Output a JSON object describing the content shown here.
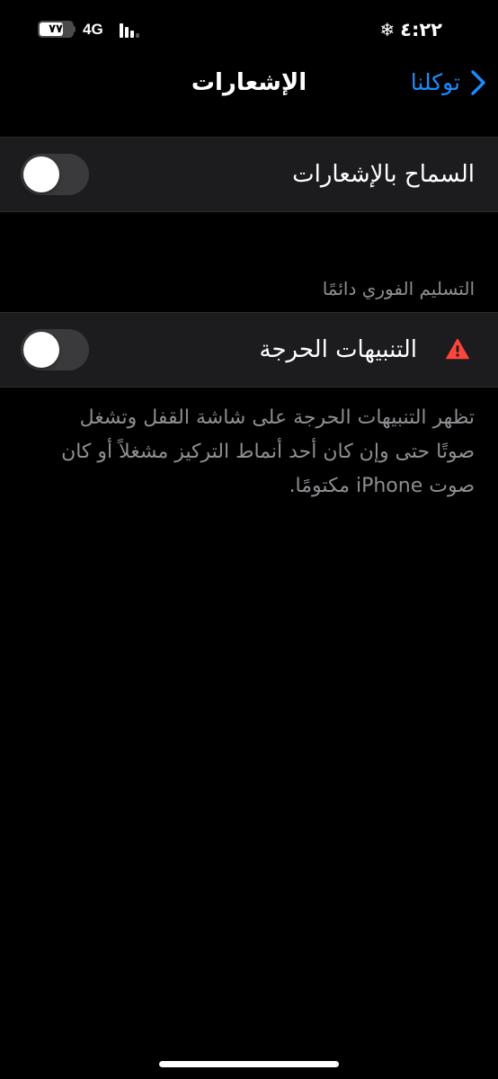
{
  "status_bar": {
    "time": "٤:٢٢",
    "network": "4G",
    "battery_level": "٧٧",
    "battery_fraction": 0.77,
    "weather_icon": "snowflake-icon",
    "signal_bars_active": 3,
    "signal_bars_total": 4
  },
  "nav": {
    "title": "الإشعارات",
    "back_label": "توكلنا",
    "back_icon": "chevron-right-icon"
  },
  "allow_notifications": {
    "label": "السماح بالإشعارات",
    "enabled": false
  },
  "immediate_delivery": {
    "header": "التسليم الفوري دائمًا"
  },
  "critical_alerts": {
    "label": "التنبيهات الحرجة",
    "icon": "warning-triangle-icon",
    "enabled": false,
    "description": "تظهر التنبيهات الحرجة على شاشة القفل وتشغل صوتًا حتى وإن كان أحد أنماط التركيز مشغلاً أو كان صوت iPhone مكتومًا."
  },
  "colors": {
    "background": "#000000",
    "cell_background": "#1c1c1e",
    "accent": "#1a8cff",
    "secondary_text": "#8e8e93",
    "toggle_off": "#3a3a3c",
    "warning": "#ff453a"
  }
}
